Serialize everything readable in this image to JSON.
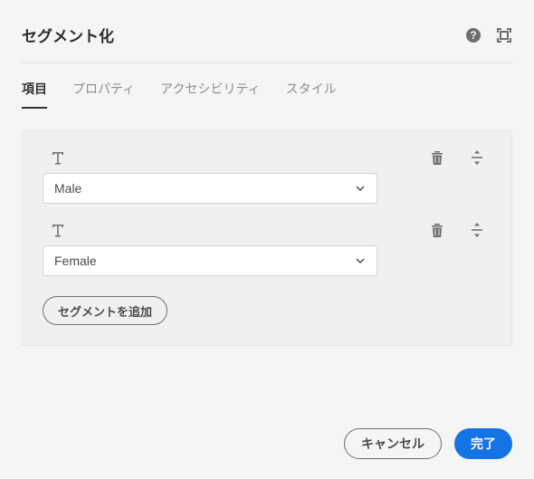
{
  "header": {
    "title": "セグメント化"
  },
  "tabs": {
    "items": [
      {
        "label": "項目"
      },
      {
        "label": "プロパティ"
      },
      {
        "label": "アクセシビリティ"
      },
      {
        "label": "スタイル"
      }
    ]
  },
  "segments": [
    {
      "value": "Male"
    },
    {
      "value": "Female"
    }
  ],
  "addButton": {
    "label": "セグメントを追加"
  },
  "footer": {
    "cancel": "キャンセル",
    "done": "完了"
  }
}
